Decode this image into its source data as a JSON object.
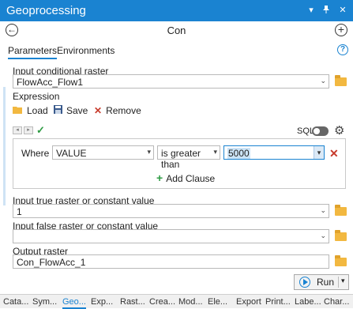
{
  "pane": {
    "title": "Geoprocessing",
    "menu_icon": "▾",
    "pin_icon": "📌",
    "close_icon": "✕"
  },
  "header": {
    "back_icon": "←",
    "tool_title": "Con",
    "add_icon": "+"
  },
  "tabs": [
    {
      "label": "Parameters",
      "active": true
    },
    {
      "label": "Environments",
      "active": false
    }
  ],
  "help_icon": "?",
  "params": {
    "input_conditional_raster": {
      "label": "Input conditional raster",
      "value": "FlowAcc_Flow1"
    },
    "expression_label": "Expression",
    "input_true": {
      "label": "Input true raster or constant value",
      "value": "1"
    },
    "input_false": {
      "label": "Input false raster or constant value",
      "value": ""
    },
    "output_raster": {
      "label": "Output raster",
      "value": "Con_FlowAcc_1"
    }
  },
  "expression_toolbar": {
    "load_label": "Load",
    "save_label": "Save",
    "remove_label": "Remove",
    "sql_label": "SQL",
    "sql_enabled": false
  },
  "clause": {
    "where_label": "Where",
    "field": "VALUE",
    "operator": "is greater than",
    "value": "5000",
    "add_clause_label": "Add Clause"
  },
  "run_label": "Run",
  "bottom_tabs": [
    "Cata...",
    "Sym...",
    "Geo...",
    "Exp...",
    "Rast...",
    "Crea...",
    "Mod...",
    "Ele...",
    "Export",
    "Print...",
    "Labe...",
    "Char..."
  ],
  "active_bottom_tab": "Geo...",
  "colors": {
    "accent": "#1a83d1",
    "folder": "#f2b840",
    "remove": "#c73a2b",
    "add": "#2e9b43"
  }
}
